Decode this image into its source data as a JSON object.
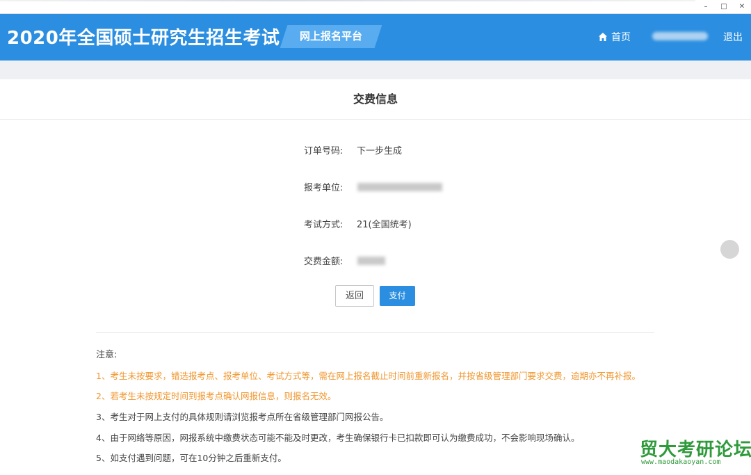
{
  "window": {
    "controls": {
      "minimize": "–",
      "maximize": "□",
      "close": "✕"
    }
  },
  "header": {
    "exam_title": "2020年全国硕士研究生招生考试",
    "platform_label": "网上报名平台",
    "home_label": "首页",
    "home_icon": "home-icon",
    "logout_label": "退出"
  },
  "card": {
    "title": "交费信息",
    "rows": [
      {
        "label": "订单号码:",
        "value": "下一步生成"
      },
      {
        "label": "报考单位:",
        "value": ""
      },
      {
        "label": "考试方式:",
        "value": "21(全国统考)"
      },
      {
        "label": "交费金额:",
        "value": ""
      }
    ],
    "back_label": "返回",
    "pay_label": "支付"
  },
  "notes": {
    "title": "注意:",
    "items": [
      "1、考生未按要求，错选报考点、报考单位、考试方式等，需在网上报名截止时间前重新报名，并按省级管理部门要求交费，逾期亦不再补报。",
      "2、若考生未按规定时间到报考点确认网报信息，则报名无效。",
      "3、考生对于网上支付的具体规则请浏览报考点所在省级管理部门网报公告。",
      "4、由于网络等原因，网报系统中缴费状态可能不能及时更改，考生确保银行卡已扣款即可认为缴费成功，不会影响现场确认。",
      "5、如支付遇到问题，可在10分钟之后重新支付。"
    ]
  },
  "watermark": {
    "title": "贸大考研论坛",
    "url": "www.maodakaoyan.com"
  },
  "colors": {
    "header_bg": "#2b8ee0",
    "primary_button": "#2b8ee0",
    "warning_text": "#f0962e",
    "watermark": "#2f9a3b"
  }
}
